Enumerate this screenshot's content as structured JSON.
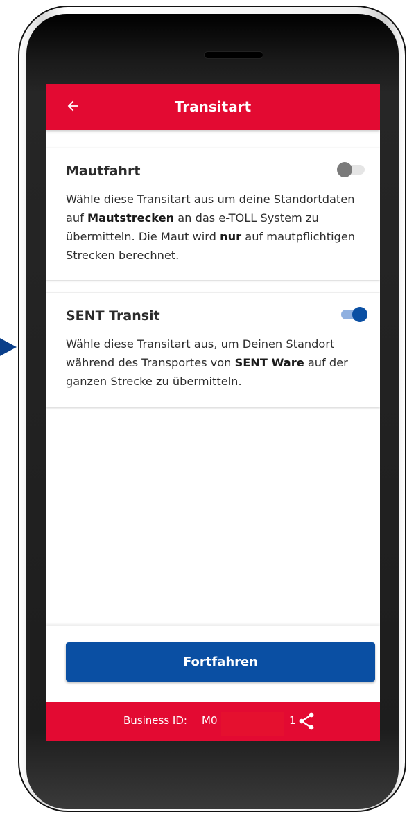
{
  "app": {
    "title": "Transitart",
    "back_icon": "arrow-left-icon"
  },
  "options": [
    {
      "title": "Mautfahrt",
      "enabled": false,
      "text_parts": [
        {
          "t": "Wähle diese Transitart aus um deine Standortdaten auf ",
          "b": false
        },
        {
          "t": "Mautstrecken",
          "b": true
        },
        {
          "t": " an das e-TOLL System zu übermitteln. Die Maut wird ",
          "b": false
        },
        {
          "t": "nur",
          "b": true
        },
        {
          "t": " auf mautpflichtigen Strecken berechnet.",
          "b": false
        }
      ]
    },
    {
      "title": "SENT Transit",
      "enabled": true,
      "text_parts": [
        {
          "t": "Wähle diese Transitart aus, um Deinen Standort während des Transportes von ",
          "b": false
        },
        {
          "t": "SENT Ware",
          "b": true
        },
        {
          "t": " auf der ganzen Strecke zu übermitteln.",
          "b": false
        }
      ]
    }
  ],
  "continue_label": "Fortfahren",
  "footer": {
    "business_id_label": "Business ID:",
    "business_id_start": "M0",
    "business_id_end": "1",
    "share_icon": "share-icon"
  },
  "colors": {
    "brand_red": "#e30a32",
    "brand_blue": "#0a4fa3"
  }
}
